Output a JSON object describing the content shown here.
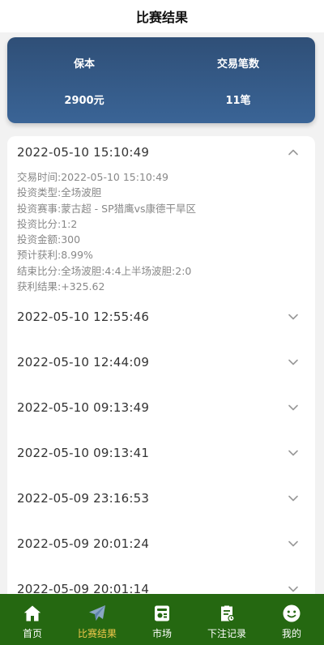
{
  "header": {
    "title": "比赛结果"
  },
  "summary": {
    "principal_label": "保本",
    "principal_value": "2900元",
    "trades_label": "交易笔数",
    "trades_value": "11笔"
  },
  "records": [
    {
      "date": "2022-05-10 15:10:49",
      "expanded": true,
      "details": [
        "交易时间:2022-05-10 15:10:49",
        "投资类型:全场波胆",
        "投资赛事:蒙古超 - SP猎鹰vs康德干旱区",
        "投资比分:1:2",
        "投资金额:300",
        "预计获利:8.99%",
        "结束比分:全场波胆:4:4上半场波胆:2:0",
        "获利结果:+325.62"
      ]
    },
    {
      "date": "2022-05-10 12:55:46",
      "expanded": false
    },
    {
      "date": "2022-05-10 12:44:09",
      "expanded": false
    },
    {
      "date": "2022-05-10 09:13:49",
      "expanded": false
    },
    {
      "date": "2022-05-10 09:13:41",
      "expanded": false
    },
    {
      "date": "2022-05-09 23:16:53",
      "expanded": false
    },
    {
      "date": "2022-05-09 20:01:24",
      "expanded": false
    },
    {
      "date": "2022-05-09 20:01:14",
      "expanded": false
    }
  ],
  "tabbar": {
    "tabs": [
      {
        "label": "首页",
        "icon": "home-icon"
      },
      {
        "label": "比赛结果",
        "icon": "paper-plane-icon",
        "active": true
      },
      {
        "label": "市场",
        "icon": "market-icon"
      },
      {
        "label": "下注记录",
        "icon": "clipboard-icon"
      },
      {
        "label": "我的",
        "icon": "smiley-icon"
      }
    ],
    "active_color": "#f2c94c"
  },
  "colors": {
    "tabbar_bg": "#256811",
    "summary_gradient_top": "#2f4f77",
    "summary_gradient_bottom": "#3a6496"
  }
}
